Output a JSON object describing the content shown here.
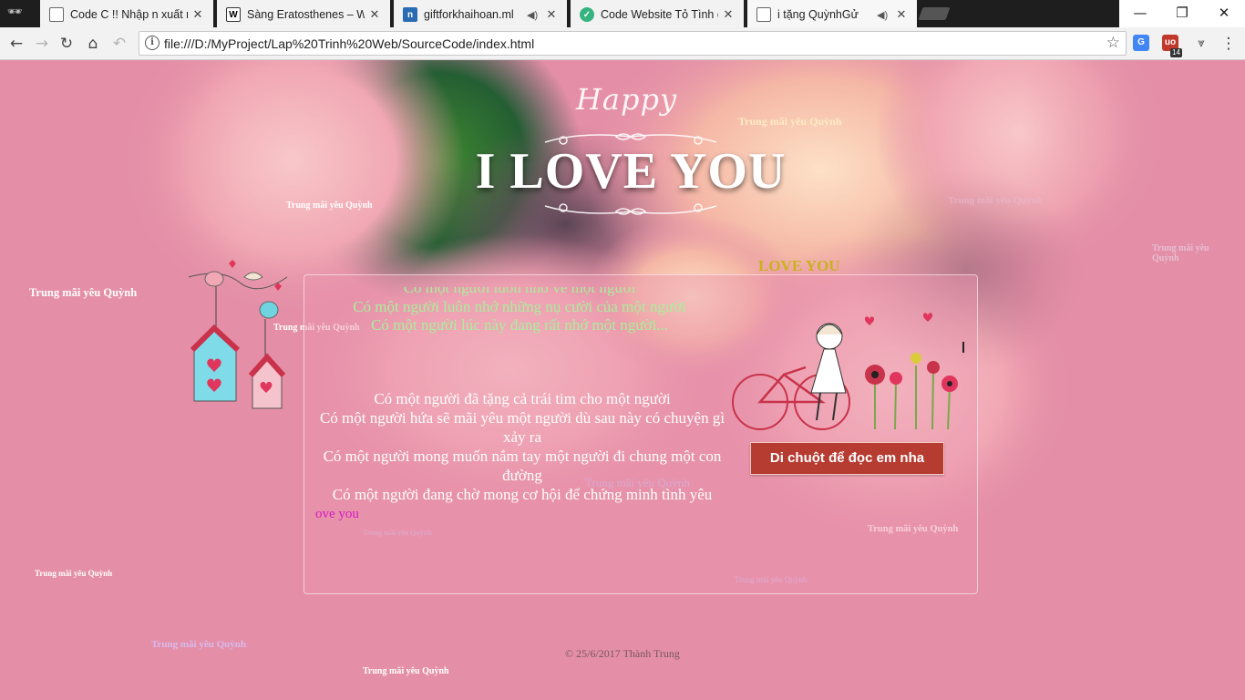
{
  "browser": {
    "tabs": [
      {
        "title": "Code C !! Nhập n xuất ra",
        "favicon": "page-icon",
        "audio": false
      },
      {
        "title": "Sàng Eratosthenes – Wik",
        "favicon": "wikipedia-icon",
        "audio": false
      },
      {
        "title": "giftforkhaihoan.ml",
        "favicon": "site-icon",
        "audio": true
      },
      {
        "title": "Code Website Tỏ Tình ch",
        "favicon": "check-icon",
        "audio": false
      },
      {
        "title": "i tặng QuỳnhGử",
        "favicon": "page-icon",
        "audio": true,
        "active": true
      }
    ],
    "url": "file:///D:/MyProject/Lap%20Trinh%20Web/SourceCode/index.html",
    "extensions": [
      {
        "name": "google-translate-icon",
        "color": "#4285f4"
      },
      {
        "name": "ublock-icon",
        "color": "#c0392b",
        "badge": "14"
      }
    ]
  },
  "page": {
    "happy": "Happy",
    "headline": "I LOVE YOU",
    "love_you_heading": "LOVE YOU",
    "green_lines": [
      "Có một người luôn nhớ về một người",
      "Có một người luôn nhớ những nụ cười của một người",
      "Có một người lúc này đang rất nhớ một người..."
    ],
    "story_lines": [
      "Có một người đã tặng cả trái tim cho một người",
      "Có một người hứa sẽ mãi yêu một người dù sau này có chuyện gì xảy ra",
      "Có một người mong muốn nắm tay một người đi chung một con đường",
      "Có một người đang chờ mong cơ hội để chứng minh tình yêu"
    ],
    "love_you_small": "ove you",
    "read_button": "Di chuột để đọc em nha",
    "footer": "© 25/6/2017 Thành Trung",
    "floating_text": "Trung mãi yêu Quỳnh"
  },
  "colors": {
    "background": "#e48fa7",
    "button": "#b63b31",
    "green_text": "#a7f09a",
    "heading_gold": "#c9b21c",
    "magenta": "#d219c6"
  }
}
